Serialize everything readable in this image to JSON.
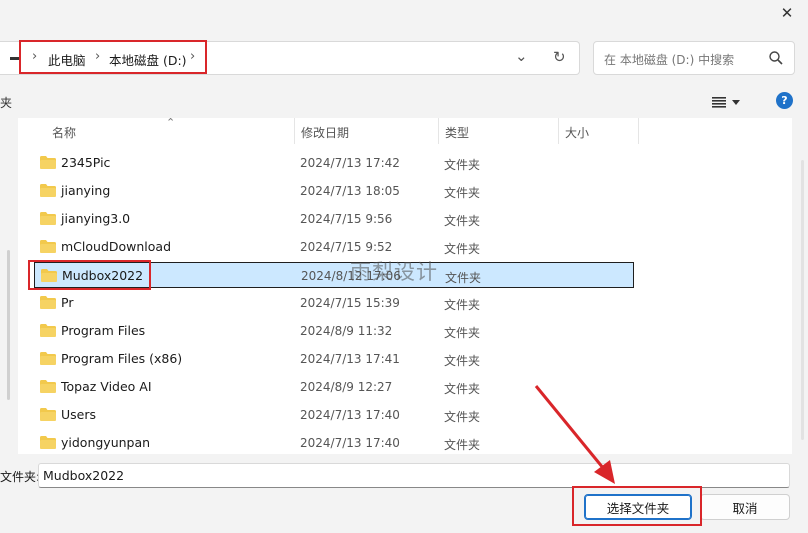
{
  "window": {
    "close_glyph": "✕"
  },
  "address_bar": {
    "breadcrumbs": [
      "此电脑",
      "本地磁盘 (D:)"
    ],
    "refresh_glyph": "↻",
    "dropdown_glyph": "⌄"
  },
  "search": {
    "placeholder": "在 本地磁盘 (D:) 中搜索"
  },
  "toolbar": {
    "left_label": "夹",
    "help_label": "?"
  },
  "columns": {
    "name": "名称",
    "date": "修改日期",
    "type": "类型",
    "size": "大小"
  },
  "rows": [
    {
      "name": "2345Pic",
      "date": "2024/7/13 17:42",
      "type": "文件夹"
    },
    {
      "name": "jianying",
      "date": "2024/7/13 18:05",
      "type": "文件夹"
    },
    {
      "name": "jianying3.0",
      "date": "2024/7/15 9:56",
      "type": "文件夹"
    },
    {
      "name": "mCloudDownload",
      "date": "2024/7/15 9:52",
      "type": "文件夹"
    },
    {
      "name": "Mudbox2022",
      "date": "2024/8/12 17:06",
      "type": "文件夹"
    },
    {
      "name": "Pr",
      "date": "2024/7/15 15:39",
      "type": "文件夹"
    },
    {
      "name": "Program Files",
      "date": "2024/8/9 11:32",
      "type": "文件夹"
    },
    {
      "name": "Program Files (x86)",
      "date": "2024/7/13 17:41",
      "type": "文件夹"
    },
    {
      "name": "Topaz Video AI",
      "date": "2024/8/9 12:27",
      "type": "文件夹"
    },
    {
      "name": "Users",
      "date": "2024/7/13 17:40",
      "type": "文件夹"
    },
    {
      "name": "yidongyunpan",
      "date": "2024/7/13 17:40",
      "type": "文件夹"
    }
  ],
  "selected_row": 4,
  "folder_field": {
    "label": "文件夹:",
    "value": "Mudbox2022"
  },
  "buttons": {
    "select_folder": "选择文件夹",
    "cancel": "取消"
  },
  "watermark": "雨梨设计",
  "colors": {
    "accent": "#1f72c9",
    "selection": "#cce8ff",
    "annotation": "#d9262a",
    "folder": "#f2c94c"
  }
}
